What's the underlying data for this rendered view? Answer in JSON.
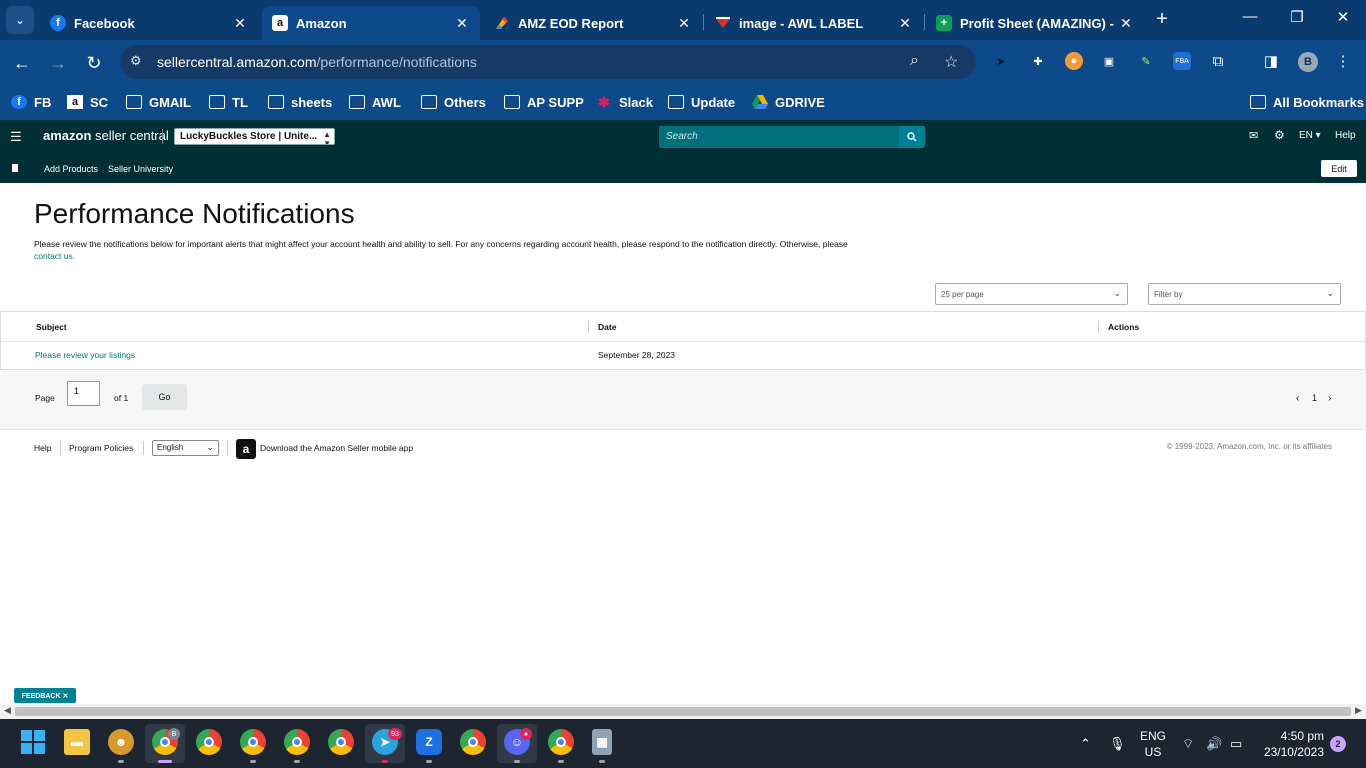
{
  "browser": {
    "tabs": [
      {
        "title": "Facebook",
        "favicon": "f"
      },
      {
        "title": "Amazon",
        "favicon": "a"
      },
      {
        "title": "AMZ EOD Report",
        "favicon": ""
      },
      {
        "title": "image - AWL LABEL",
        "favicon": ""
      },
      {
        "title": "Profit Sheet (AMAZING) - G",
        "favicon": ""
      }
    ],
    "url_host": "sellercentral.amazon.com",
    "url_path": "/performance/notifications",
    "bookmarks": [
      "FB",
      "SC",
      "GMAIL",
      "TL",
      "sheets",
      "AWL",
      "Others",
      "AP SUPP",
      "Slack",
      "Update",
      "GDRIVE"
    ],
    "all_bookmarks": "All Bookmarks",
    "profile_initial": "B",
    "colors": {
      "frame": "#0b3a6e",
      "toolbar": "#0e4a8a"
    }
  },
  "seller_header": {
    "logo_amazon": "amazon",
    "logo_rest": " seller central",
    "store": "LuckyBuckles Store | Unite...",
    "search_placeholder": "Search",
    "lang": "EN ▾",
    "help": "Help",
    "sub_links": [
      "Add Products",
      "Seller University"
    ],
    "edit": "Edit",
    "colors": {
      "header_bg": "#002f36",
      "search_bg": "#00707a"
    }
  },
  "page": {
    "title": "Performance Notifications",
    "intro": "Please review the notifications below for important alerts that might affect your account health and ability to sell. For any concerns regarding account health, please respond to the notification directly. Otherwise, please",
    "contact_link": "contact us.",
    "per_page": "25 per page",
    "filter_placeholder": "Filter by",
    "columns": {
      "subject": "Subject",
      "date": "Date",
      "actions": "Actions"
    },
    "rows": [
      {
        "subject": "Please review your listings",
        "date": "September 28, 2023",
        "actions": ""
      }
    ],
    "pager": {
      "page_label": "Page",
      "page_value": "1",
      "of_label": "of 1",
      "go": "Go",
      "prev": "‹",
      "current": "1",
      "next": "›"
    },
    "footer": {
      "help": "Help",
      "policies": "Program Policies",
      "language": "English",
      "download": "Download the Amazon Seller mobile app",
      "copyright": "© 1999-2023, Amazon.com, Inc. or its affiliates"
    },
    "feedback": "FEEDBACK ✕",
    "link_color": "#00757f"
  },
  "taskbar": {
    "telegram_badge": "93",
    "lang_line1": "ENG",
    "lang_line2": "US",
    "time": "4:50 pm",
    "date": "23/10/2023",
    "notifications": "2"
  }
}
